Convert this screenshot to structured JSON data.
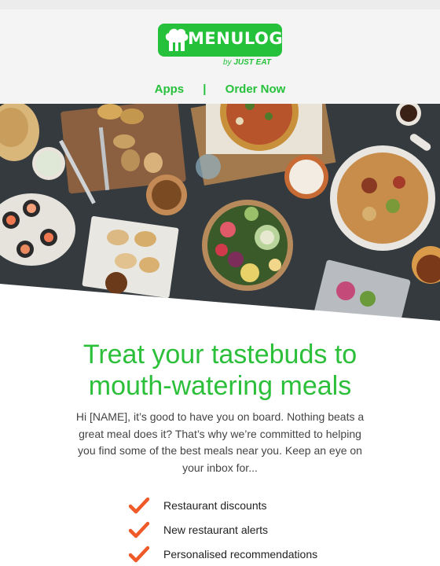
{
  "brand": {
    "name": "MENULOG",
    "by_prefix": "by",
    "by_name": "JUST EAT",
    "color": "#26c13a"
  },
  "nav": {
    "apps_label": "Apps",
    "separator": "|",
    "order_label": "Order Now"
  },
  "hero": {
    "image": "food-spread-photo"
  },
  "content": {
    "headline_line1": "Treat your tastebuds to",
    "headline_line2": "mouth-watering meals",
    "intro": "Hi [NAME], it’s good to have you on board. Nothing beats a great meal does it? That’s why we’re committed to helping you find some of the best meals near you. Keep an eye on your inbox for...",
    "checklist": [
      "Restaurant discounts",
      "New restaurant alerts",
      "Personalised recommendations"
    ],
    "check_color": "#f05a28"
  }
}
